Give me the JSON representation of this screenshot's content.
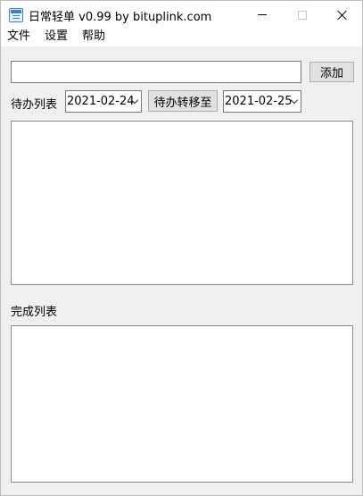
{
  "window": {
    "title": "日常轻单 v0.99 by bituplink.com"
  },
  "menu": {
    "items": [
      "文件",
      "设置",
      "帮助"
    ]
  },
  "add_row": {
    "input_value": "",
    "add_label": "添加"
  },
  "todo_row": {
    "label": "待办列表",
    "from_date": "2021-02-24",
    "move_label": "待办转移至",
    "to_date": "2021-02-25"
  },
  "todo_list": {
    "items": []
  },
  "done_section": {
    "label": "完成列表"
  },
  "done_list": {
    "items": []
  }
}
